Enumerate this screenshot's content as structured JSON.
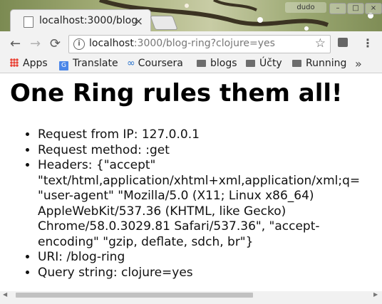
{
  "window": {
    "user_label": "dudo",
    "minimize": "–",
    "maximize": "□",
    "close": "×"
  },
  "tab": {
    "title": "localhost:3000/blog",
    "close": "×"
  },
  "toolbar": {
    "back": "←",
    "forward": "→",
    "reload": "⟳",
    "url_host": "localhost",
    "url_rest": ":3000/blog-ring?clojure=yes",
    "info": "i",
    "star": "☆",
    "menu": "⋮"
  },
  "bookmarks": {
    "items": [
      {
        "label": "Apps"
      },
      {
        "label": "Translate"
      },
      {
        "label": "Coursera"
      },
      {
        "label": "blogs"
      },
      {
        "label": "Účty"
      },
      {
        "label": "Running"
      }
    ],
    "more": "»"
  },
  "page": {
    "heading": "One Ring rules them all!",
    "items": [
      "Request from IP: 127.0.0.1",
      "Request method: :get",
      "Headers: {\"accept\"\n\"text/html,application/xhtml+xml,application/xml;q=\n\"user-agent\" \"Mozilla/5.0 (X11; Linux x86_64)\nAppleWebKit/537.36 (KHTML, like Gecko)\nChrome/58.0.3029.81 Safari/537.36\", \"accept-\nencoding\" \"gzip, deflate, sdch, br\"}",
      "URI: /blog-ring",
      "Query string: clojure=yes"
    ]
  },
  "colors": {
    "accent": "#4a86e8"
  }
}
